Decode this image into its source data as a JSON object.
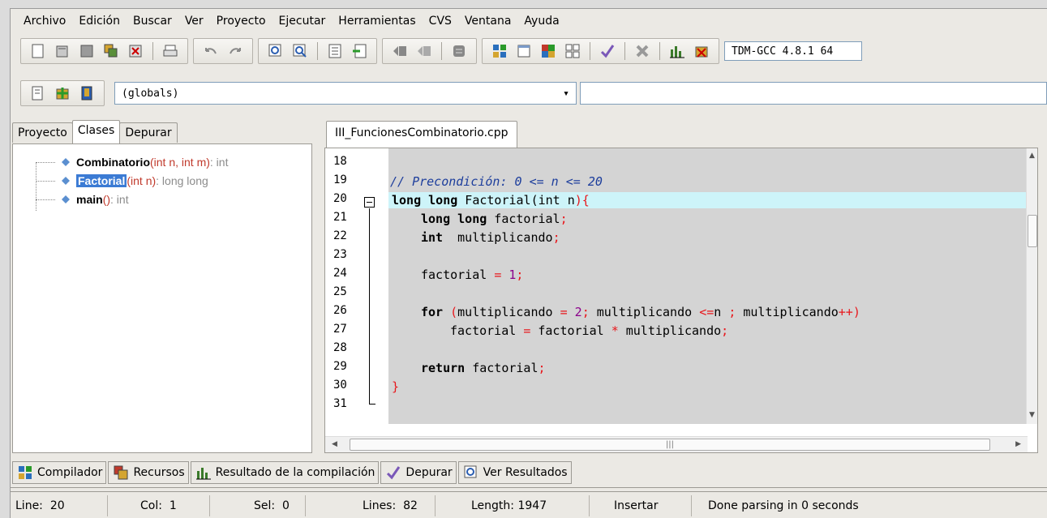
{
  "menu": [
    "Archivo",
    "Edición",
    "Buscar",
    "Ver",
    "Proyecto",
    "Ejecutar",
    "Herramientas",
    "CVS",
    "Ventana",
    "Ayuda"
  ],
  "toolbar": {
    "compiler_selected": "TDM-GCC 4.8.1 64",
    "scope_combo": "(globals)"
  },
  "left_tabs": [
    {
      "label": "Proyecto",
      "active": false
    },
    {
      "label": "Clases",
      "active": true
    },
    {
      "label": "Depurar",
      "active": false
    }
  ],
  "class_tree": [
    {
      "name": "Combinatorio",
      "params": "(int n, int m)",
      "rtype": " : int"
    },
    {
      "name": "Factorial",
      "params": "(int n)",
      "rtype": " : long long"
    },
    {
      "name": "main",
      "params": "()",
      "rtype": " : int"
    }
  ],
  "editor": {
    "file_tab": "III_FuncionesCombinatorio.cpp",
    "line_numbers": [
      "18",
      "19",
      "20",
      "21",
      "22",
      "23",
      "24",
      "25",
      "26",
      "27",
      "28",
      "29",
      "30",
      "31"
    ],
    "lines": {
      "l19_comment": "// Precondición: 0 <= n <= 20",
      "l20_kw": "long long",
      "l20_rest": " Factorial(",
      "l20_kw2": "int",
      "l20_tail": " n",
      "l20_sym": "){",
      "l21_kw": "long long",
      "l21_rest": " factorial",
      "l21_sym": ";",
      "l22_kw": "int",
      "l22_rest": "  multiplicando",
      "l22_sym": ";",
      "l24_rest": "factorial ",
      "l24_sym": "=",
      "l24_num": " 1",
      "l24_end": ";",
      "l26_kw": "for",
      "l26_p1": " ",
      "l26_paren": "(",
      "l26_rest1": "multiplicando ",
      "l26_eq": "=",
      "l26_num": " 2",
      "l26_semi": ";",
      "l26_rest2": " multiplicando ",
      "l26_le": "<=",
      "l26_rest3": "n ",
      "l26_semi2": ";",
      "l26_rest4": " multiplicando",
      "l26_pp": "++)",
      "l27_rest1": "factorial ",
      "l27_eq": "=",
      "l27_rest2": " factorial ",
      "l27_star": "*",
      "l27_rest3": " multiplicando",
      "l27_semi": ";",
      "l29_kw": "return",
      "l29_rest": " factorial",
      "l29_semi": ";",
      "l30_brace": "}"
    }
  },
  "bottom_tabs": [
    "Compilador",
    "Recursos",
    "Resultado de la compilación",
    "Depurar",
    "Ver Resultados"
  ],
  "status": {
    "line_label": "Line:",
    "line_val": "20",
    "col_label": "Col:",
    "col_val": "1",
    "sel_label": "Sel:",
    "sel_val": "0",
    "lines_label": "Lines:",
    "lines_val": "82",
    "length_label": "Length:",
    "length_val": "1947",
    "mode": "Insertar",
    "message": "Done parsing in 0 seconds"
  }
}
